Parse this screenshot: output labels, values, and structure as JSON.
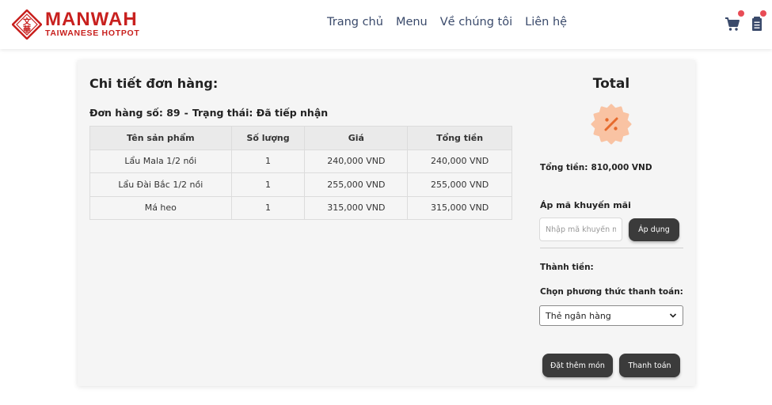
{
  "header": {
    "brand_name": "MANWAH",
    "brand_sub": "TAIWANESE HOTPOT",
    "nav": [
      {
        "label": "Trang chủ"
      },
      {
        "label": "Menu"
      },
      {
        "label": "Về chúng tôi"
      },
      {
        "label": "Liên hệ"
      }
    ],
    "icons": [
      "cart-icon",
      "order-list-icon"
    ],
    "badge_color": "#e84c56"
  },
  "order": {
    "title": "Chi tiết đơn hàng:",
    "number_text": "Đơn hàng số: 89",
    "separator": "-",
    "status_text": "Trạng thái: Đã tiếp nhận",
    "columns": [
      "Tên sản phẩm",
      "Số lượng",
      "Giá",
      "Tổng tiền"
    ],
    "rows": [
      [
        "Lẩu Mala 1/2 nồi",
        "1",
        "240,000 VND",
        "240,000 VND"
      ],
      [
        "Lẩu Đài Bắc 1/2 nồi",
        "1",
        "255,000 VND",
        "255,000 VND"
      ],
      [
        "Má heo",
        "1",
        "315,000 VND",
        "315,000 VND"
      ]
    ]
  },
  "summary": {
    "title": "Total",
    "total_label": "Tổng tiền:",
    "total_value": "810,000 VND",
    "promo_label": "Áp mã khuyến mãi",
    "promo_placeholder": "Nhập mã khuyến mãi",
    "promo_value": "",
    "apply_label": "Áp dụng",
    "final_label": "Thành tiền:",
    "payment_label": "Chọn phương thức thanh toán:",
    "payment_selected": "Thẻ ngân hàng",
    "more_label": "Đặt thêm món",
    "checkout_label": "Thanh toán"
  },
  "colors": {
    "brand_red": "#c8201e",
    "button_dark": "#3b3b3b",
    "badge_orange": "#f9c3a3"
  }
}
